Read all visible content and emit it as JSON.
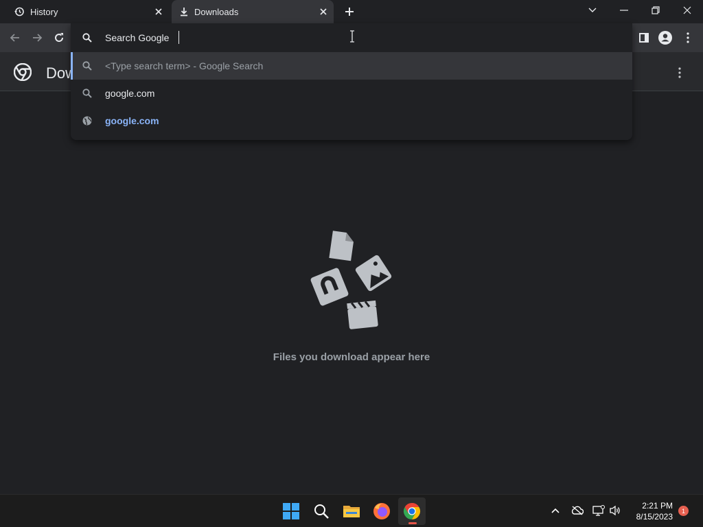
{
  "tabs": [
    {
      "label": "History",
      "icon": "history-icon"
    },
    {
      "label": "Downloads",
      "icon": "download-icon",
      "active": true
    }
  ],
  "omnibox": {
    "value": "Search Google",
    "suggestions": [
      {
        "text": "<Type search term> - Google Search",
        "icon": "search-icon",
        "selected": true
      },
      {
        "text": "google.com",
        "icon": "search-icon"
      },
      {
        "text": "google.com",
        "icon": "globe-icon"
      }
    ]
  },
  "page": {
    "title": "Downloads",
    "empty_message": "Files you download appear here"
  },
  "taskbar": {
    "time": "2:21 PM",
    "date": "8/15/2023",
    "notification_count": "1"
  },
  "colors": {
    "background": "#202124",
    "toolbar": "#35363a",
    "accent": "#8ab4f8",
    "taskbar": "#1c1c1c"
  }
}
